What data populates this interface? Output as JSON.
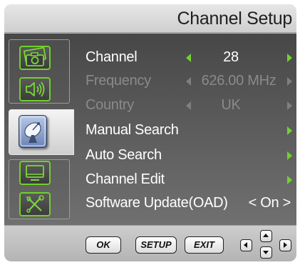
{
  "title": "Channel Setup",
  "colors": {
    "accent": "#72d22c",
    "disabled": "#8a8a8a",
    "text": "#ffffff"
  },
  "sidebar": {
    "items": [
      {
        "icon": "picture-camera-icon",
        "selected": false
      },
      {
        "icon": "speaker-sound-icon",
        "selected": false
      },
      {
        "icon": "satellite-dish-icon",
        "selected": true
      },
      {
        "icon": "monitor-icon",
        "selected": false
      },
      {
        "icon": "tools-icon",
        "selected": false
      }
    ]
  },
  "menu": {
    "channel": {
      "label": "Channel",
      "value": "28"
    },
    "frequency": {
      "label": "Frequency",
      "value": "626.00 MHz"
    },
    "country": {
      "label": "Country",
      "value": "UK"
    },
    "manual_search": {
      "label": "Manual Search"
    },
    "auto_search": {
      "label": "Auto Search"
    },
    "channel_edit": {
      "label": "Channel Edit"
    },
    "software_update": {
      "label": "Software Update(OAD)",
      "value": "< On >"
    }
  },
  "footer": {
    "ok": "OK",
    "setup": "SETUP",
    "exit": "EXIT",
    "nav_icons": [
      "left-arrow-icon",
      "up-arrow-icon",
      "down-arrow-icon",
      "right-arrow-icon"
    ]
  }
}
